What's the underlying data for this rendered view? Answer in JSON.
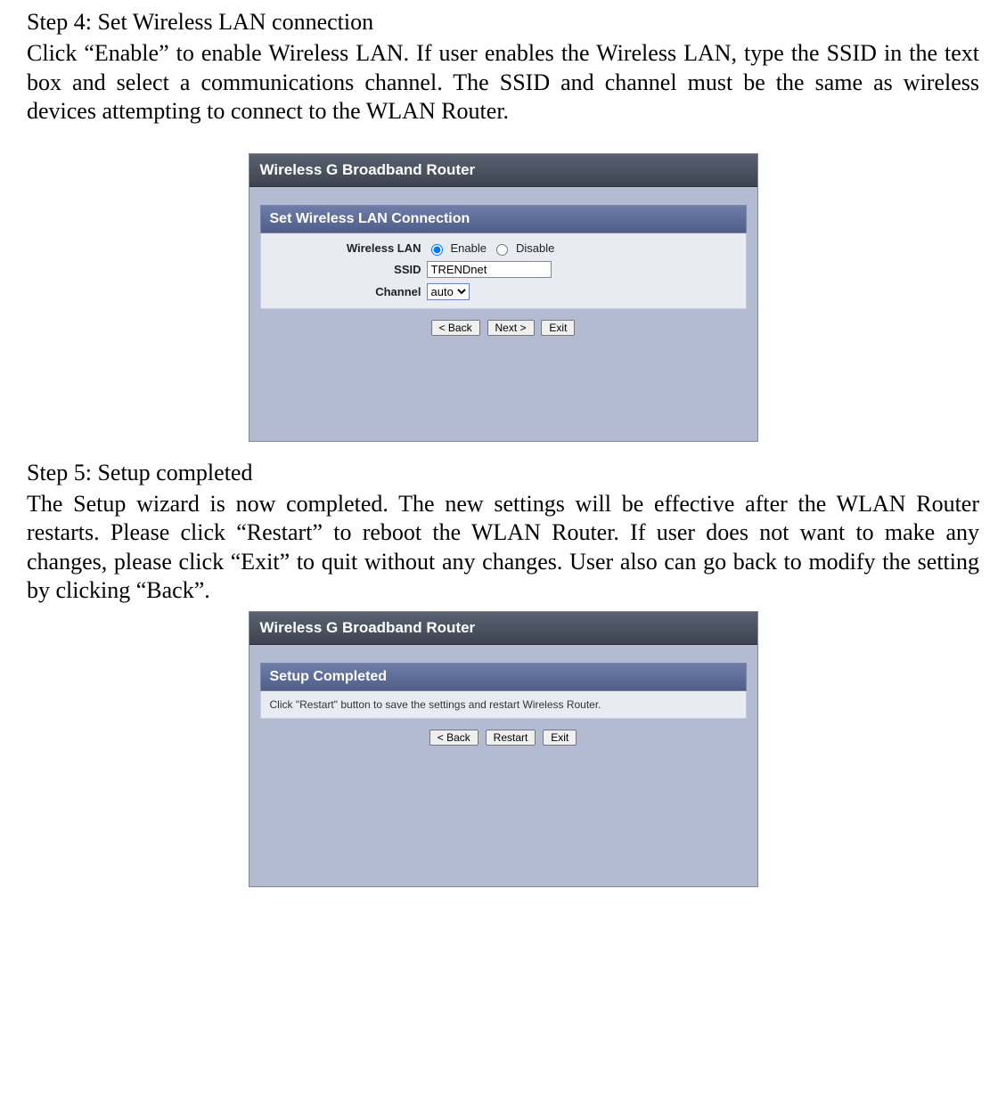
{
  "doc": {
    "step4_title": "Step 4: Set Wireless LAN connection",
    "step4_body": "Click “Enable” to enable Wireless LAN. If user enables the Wireless LAN, type the SSID in the text box and select a communications channel. The SSID and channel must be the same as wireless devices attempting to connect to the WLAN Router.",
    "step5_title": "Step 5: Setup completed",
    "step5_body": "The Setup wizard is now completed. The new settings will be effective after the WLAN Router restarts. Please click “Restart” to reboot the WLAN Router. If user does not want to make any changes, please click “Exit” to quit without any changes. User also can go back to modify the setting by clicking “Back”."
  },
  "panel1": {
    "header": "Wireless G Broadband Router",
    "section": "Set Wireless LAN Connection",
    "labels": {
      "wlan": "Wireless LAN",
      "ssid": "SSID",
      "channel": "Channel"
    },
    "radio": {
      "enable": "Enable",
      "disable": "Disable",
      "selected": "enable"
    },
    "ssid_value": "TRENDnet",
    "channel_value": "auto",
    "buttons": {
      "back": "< Back",
      "next": "Next >",
      "exit": "Exit"
    }
  },
  "panel2": {
    "header": "Wireless G Broadband Router",
    "section": "Setup Completed",
    "instruction": "Click \"Restart\" button to save the settings and restart Wireless Router.",
    "buttons": {
      "back": "< Back",
      "restart": "Restart",
      "exit": "Exit"
    }
  }
}
